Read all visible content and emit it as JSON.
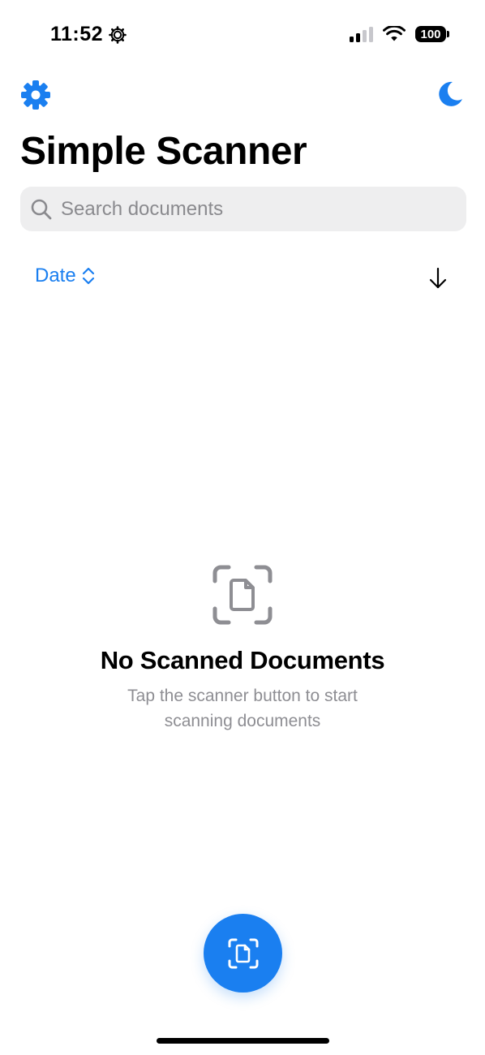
{
  "status_bar": {
    "time": "11:52",
    "battery": "100",
    "signal_bars_active": 2,
    "signal_bars_total": 4
  },
  "nav": {
    "left_icon": "gear-icon",
    "right_icon": "moon-icon"
  },
  "title": "Simple Scanner",
  "search": {
    "placeholder": "Search documents",
    "value": ""
  },
  "sort": {
    "label": "Date",
    "order_icon": "arrow-down-icon"
  },
  "empty_state": {
    "icon": "document-scan-icon",
    "title": "No Scanned Documents",
    "subtitle": "Tap the scanner button to start scanning documents"
  },
  "fab": {
    "icon": "document-scan-icon"
  },
  "colors": {
    "accent": "#1a7ff0",
    "muted_text": "#8e8e93",
    "search_bg": "#eeeeef",
    "empty_icon": "#8e8e93"
  }
}
